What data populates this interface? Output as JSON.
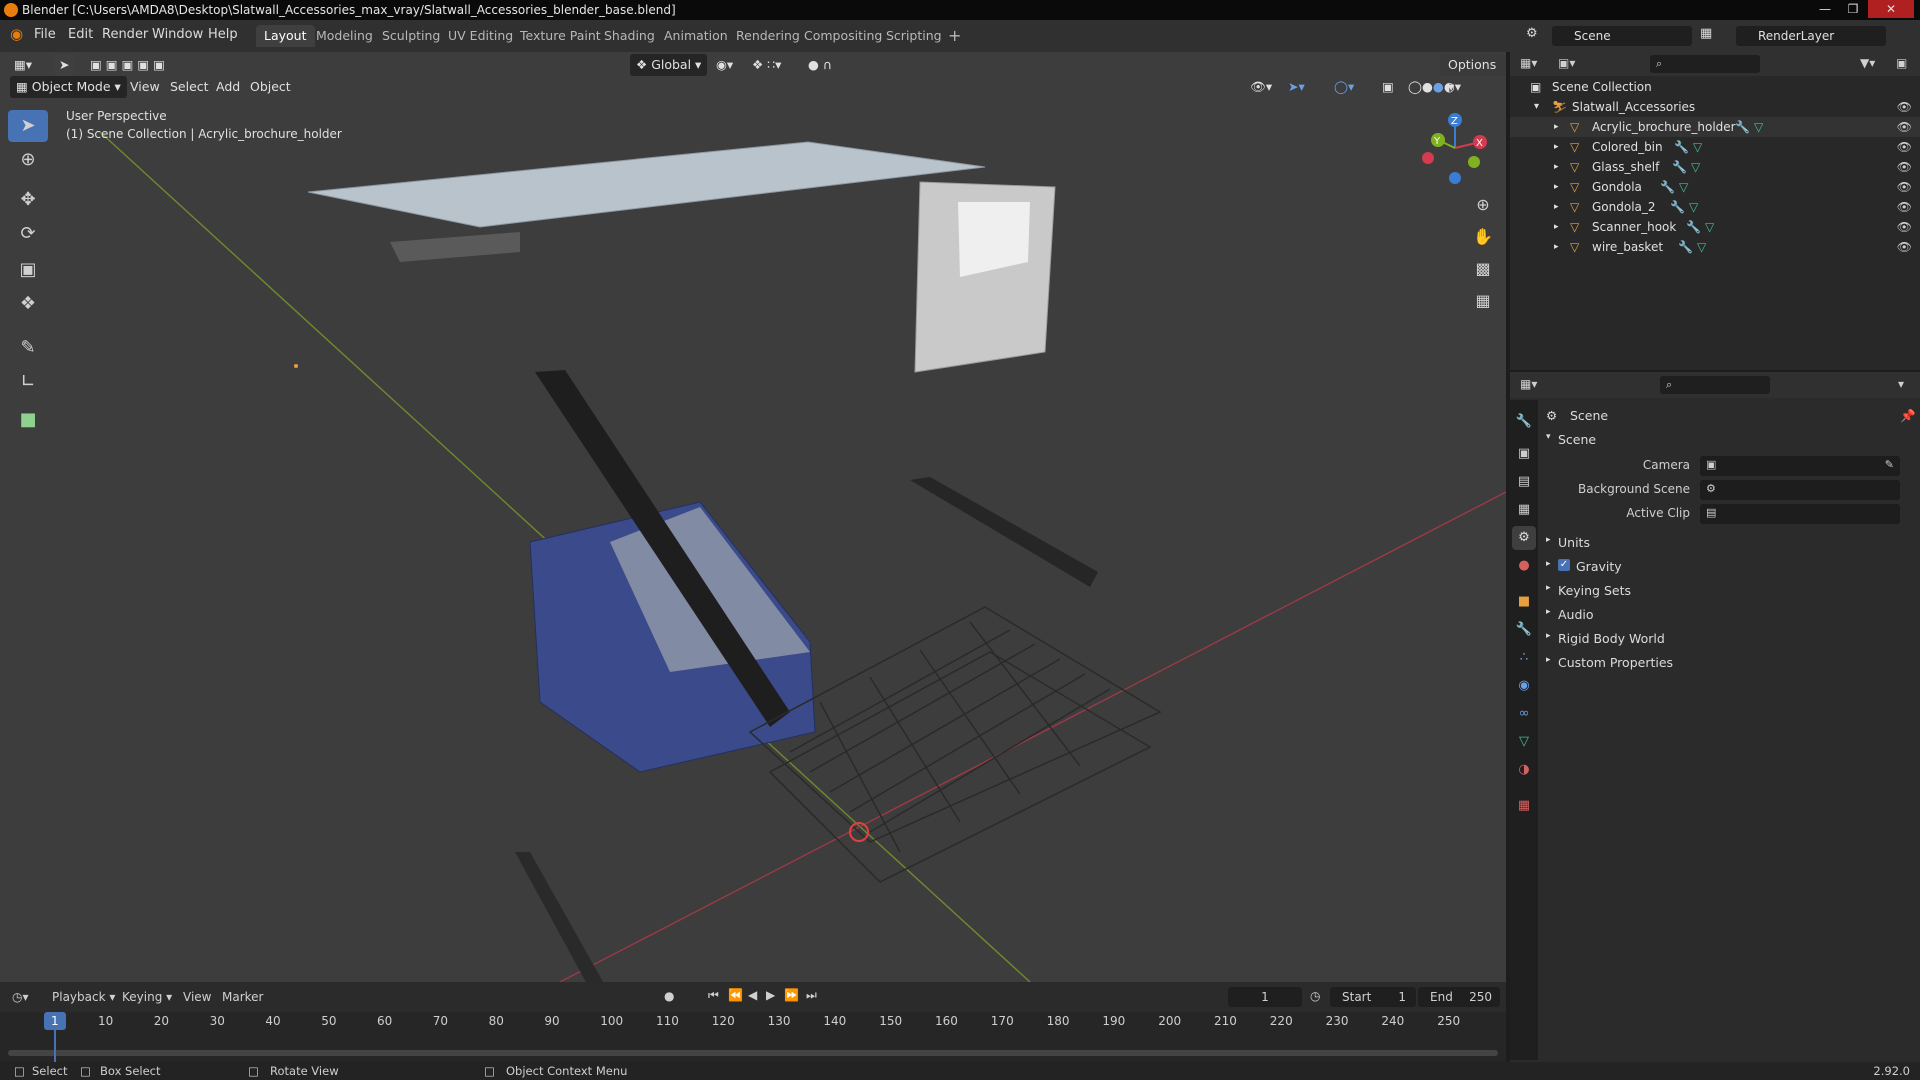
{
  "window": {
    "title": "Blender [C:\\Users\\AMDA8\\Desktop\\Slatwall_Accessories_max_vray/Slatwall_Accessories_blender_base.blend]"
  },
  "menus": [
    "File",
    "Edit",
    "Render",
    "Window",
    "Help"
  ],
  "workspaces": [
    "Layout",
    "Modeling",
    "Sculpting",
    "UV Editing",
    "Texture Paint",
    "Shading",
    "Animation",
    "Rendering",
    "Compositing",
    "Scripting"
  ],
  "active_workspace": "Layout",
  "scene_field": "Scene",
  "render_layer_field": "RenderLayer",
  "toolbar": {
    "transform_orientation": "Global",
    "options_label": "Options"
  },
  "viewport": {
    "mode": "Object Mode",
    "menus": [
      "View",
      "Select",
      "Add",
      "Object"
    ],
    "perspective_label": "User Perspective",
    "collection_label": "(1) Scene Collection | Acrylic_brochure_holder",
    "gizmo_axes": {
      "x": "X",
      "y": "Y",
      "z": "Z"
    }
  },
  "outliner": {
    "root": "Scene Collection",
    "collection": "Slatwall_Accessories",
    "objects": [
      "Acrylic_brochure_holder",
      "Colored_bin",
      "Glass_shelf",
      "Gondola",
      "Gondola_2",
      "Scanner_hook",
      "wire_basket"
    ]
  },
  "properties": {
    "header": "Scene",
    "panel_title": "Scene",
    "fields": [
      {
        "label": "Camera"
      },
      {
        "label": "Background Scene"
      },
      {
        "label": "Active Clip"
      }
    ],
    "panels": [
      "Units",
      "Gravity",
      "Keying Sets",
      "Audio",
      "Rigid Body World",
      "Custom Properties"
    ],
    "gravity_checked": true
  },
  "timeline": {
    "menus": [
      "Playback",
      "Keying",
      "View",
      "Marker"
    ],
    "current_frame": "1",
    "start_label": "Start",
    "start_value": "1",
    "end_label": "End",
    "end_value": "250",
    "ticks": [
      "1",
      "10",
      "20",
      "30",
      "40",
      "50",
      "60",
      "70",
      "80",
      "90",
      "100",
      "110",
      "120",
      "130",
      "140",
      "150",
      "160",
      "170",
      "180",
      "190",
      "200",
      "210",
      "220",
      "230",
      "240",
      "250"
    ]
  },
  "statusbar": {
    "select": "Select",
    "box_select": "Box Select",
    "rotate_view": "Rotate View",
    "context_menu": "Object Context Menu",
    "version": "2.92.0"
  },
  "colors": {
    "accent": "#4772b3",
    "object_orange": "#e7a040",
    "x_axis": "#d43b4f",
    "y_axis": "#7fb21e",
    "z_axis": "#3b7dd4"
  }
}
